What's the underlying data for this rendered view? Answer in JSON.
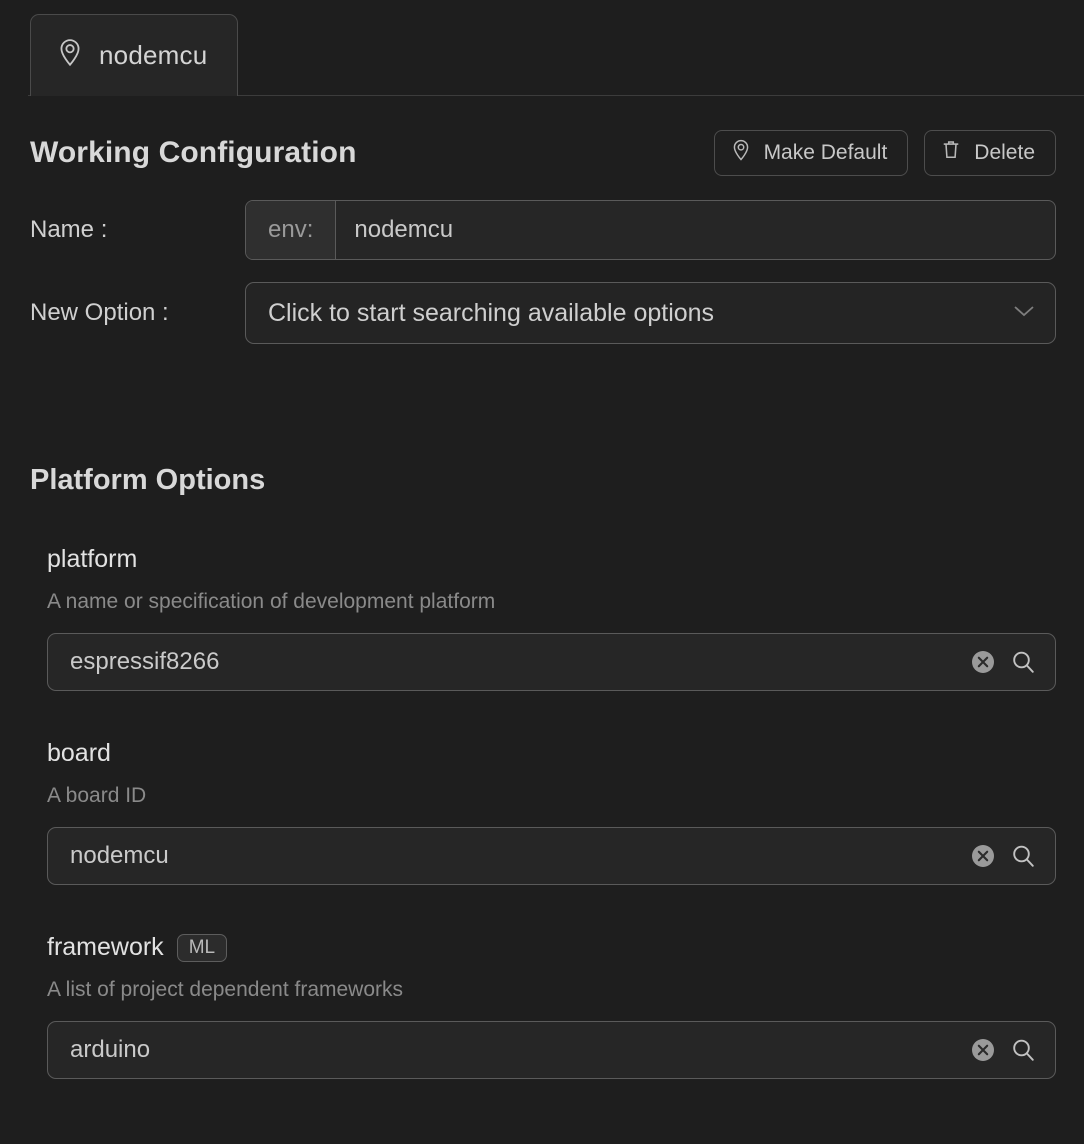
{
  "tab": {
    "label": "nodemcu",
    "icon": "map-pin-icon"
  },
  "header": {
    "title": "Working Configuration",
    "make_default_label": "Make Default",
    "make_default_icon": "map-pin-icon",
    "delete_label": "Delete",
    "delete_icon": "trash-icon"
  },
  "form": {
    "name_label": "Name :",
    "name_prefix": "env:",
    "name_value": "nodemcu",
    "new_option_label": "New Option :",
    "new_option_value": "Click to start searching available options",
    "new_option_icon": "chevron-down-icon"
  },
  "platform_options": {
    "section_title": "Platform Options",
    "options": [
      {
        "name": "platform",
        "badge": null,
        "description": "A name or specification of development platform",
        "value": "espressif8266",
        "clear_icon": "clear-circle-icon",
        "search_icon": "search-icon"
      },
      {
        "name": "board",
        "badge": null,
        "description": "A board ID",
        "value": "nodemcu",
        "clear_icon": "clear-circle-icon",
        "search_icon": "search-icon"
      },
      {
        "name": "framework",
        "badge": "ML",
        "description": "A list of project dependent frameworks",
        "value": "arduino",
        "clear_icon": "clear-circle-icon",
        "search_icon": "search-icon"
      }
    ]
  },
  "colors": {
    "background": "#1e1e1e",
    "panel": "#262626",
    "border": "#5a5a5a",
    "text_primary": "#d8d8d8",
    "text_secondary": "#8a8a8a"
  }
}
